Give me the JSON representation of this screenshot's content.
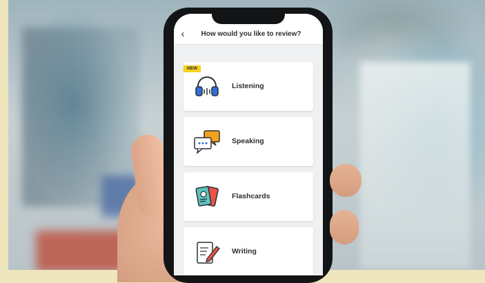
{
  "header": {
    "back_glyph": "‹",
    "title": "How would you like to review?"
  },
  "options": [
    {
      "label": "Listening",
      "icon": "headphones-icon",
      "badge": "NEW"
    },
    {
      "label": "Speaking",
      "icon": "speech-bubbles-icon"
    },
    {
      "label": "Flashcards",
      "icon": "flashcards-icon"
    },
    {
      "label": "Writing",
      "icon": "writing-pencil-icon"
    }
  ],
  "colors": {
    "badge": "#f7d11c",
    "accent_blue": "#2f6fd8",
    "accent_orange": "#f2a21d",
    "accent_teal": "#5cc3c0",
    "accent_red": "#e8534a"
  }
}
